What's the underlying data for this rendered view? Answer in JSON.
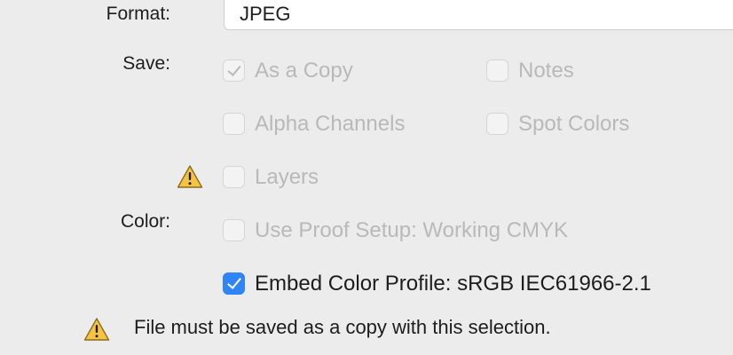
{
  "labels": {
    "format": "Format:",
    "save": "Save:",
    "color": "Color:"
  },
  "format": {
    "value": "JPEG"
  },
  "save_options": {
    "as_a_copy": "As a Copy",
    "notes": "Notes",
    "alpha_channels": "Alpha Channels",
    "spot_colors": "Spot Colors",
    "layers": "Layers"
  },
  "color_options": {
    "use_proof_setup": "Use Proof Setup:  Working CMYK",
    "embed_color_profile": "Embed Color Profile:  sRGB IEC61966-2.1"
  },
  "message": {
    "text": "File must be saved as a copy with this selection."
  },
  "icons": {
    "warning": "warning-triangle-icon"
  },
  "colors": {
    "checkbox_accent": "#2f84f6",
    "warning_fill": "#f6c343"
  }
}
